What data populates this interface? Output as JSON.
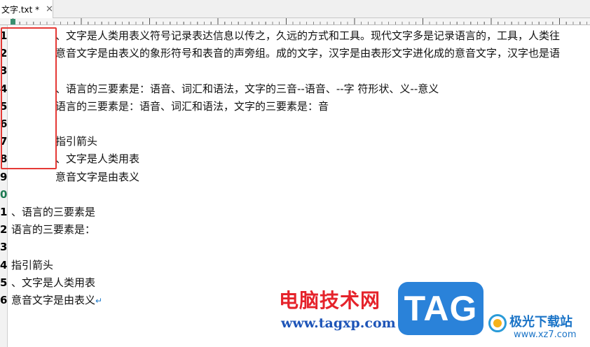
{
  "tab": {
    "title": "文字.txt *",
    "close_glyph": "✕"
  },
  "editor": {
    "line_numbers": [
      "1",
      "2",
      "3",
      "4",
      "5",
      "6",
      "7",
      "8",
      "9",
      "0",
      "1",
      "2",
      "3",
      "4",
      "5",
      "6"
    ],
    "current_line_index": 9,
    "lines": [
      "、文字是人类用表义符号记录表达信息以传之，久远的方式和工具。现代文字多是记录语言的，工具，人类往",
      "意音文字是由表义的象形符号和表音的声旁组。成的文字，汉字是由表形文字进化成的意音文字，汉字也是语",
      "",
      "、语言的三要素是：语音、词汇和语法，文字的三音--语音、--字 符形状、义--意义",
      "语言的三要素是：语音、词汇和语法，文字的三要素是：音",
      "",
      "指引箭头",
      "、文字是人类用表",
      "意音文字是由表义",
      "",
      "、语言的三要素是",
      "语言的三要素是：",
      "",
      "指引箭头",
      "、文字是人类用表",
      "意音文字是由表义"
    ],
    "end_arrow": "↵"
  },
  "watermark": {
    "site_name": "电脑技术网",
    "site_url": "www.tagxp.com",
    "tag_text": "TAG",
    "brand_name": "极光下载站",
    "brand_url": "www.xz7.com"
  },
  "colors": {
    "highlight_border": "#e53935",
    "current_line_number": "#1e7a52",
    "tag_badge": "#2a82d9"
  }
}
